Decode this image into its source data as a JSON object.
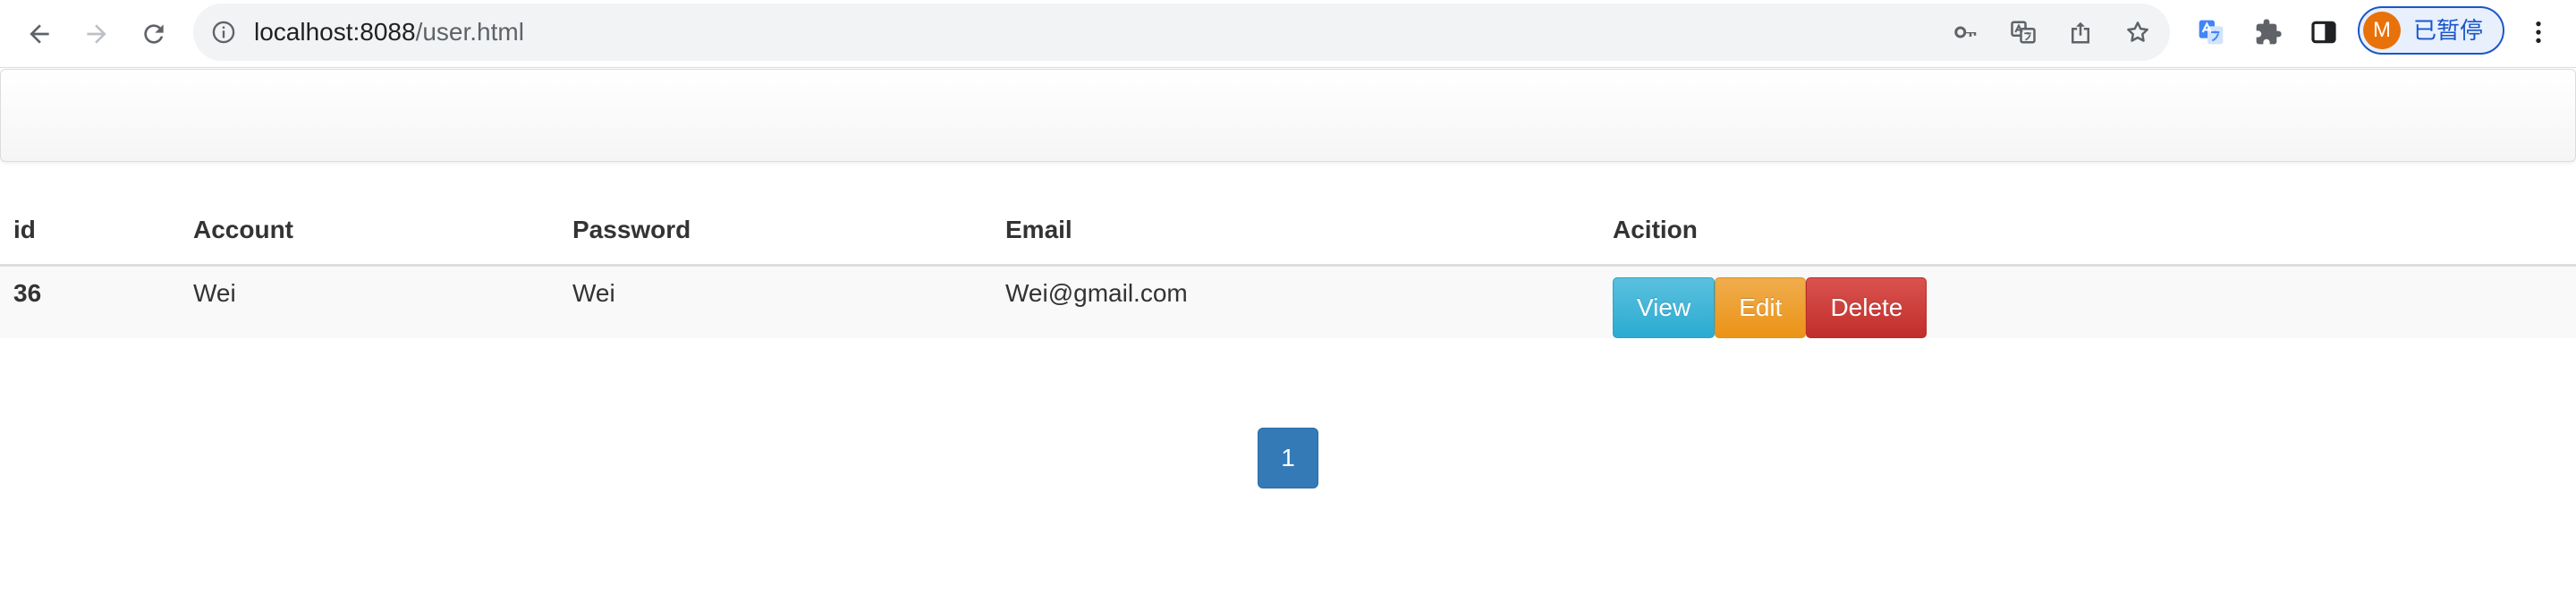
{
  "browser": {
    "url_host": "localhost:8088",
    "url_path": "/user.html",
    "profile_initial": "M",
    "profile_status": "已暂停",
    "icons": {
      "back": "back-arrow-icon",
      "forward": "forward-arrow-icon",
      "reload": "reload-icon",
      "site_info": "info-icon",
      "password": "key-icon",
      "translate": "translate-icon",
      "share": "share-icon",
      "bookmark": "star-icon",
      "translate_ext": "google-translate-icon",
      "extensions": "puzzle-icon",
      "side_panel": "side-panel-icon",
      "menu": "kebab-menu-icon"
    }
  },
  "table": {
    "headers": {
      "id": "id",
      "account": "Account",
      "password": "Password",
      "email": "Email",
      "action": "Acition"
    },
    "rows": [
      {
        "id": "36",
        "account": "Wei",
        "password": "Wei",
        "email": "Wei@gmail.com"
      }
    ],
    "actions": {
      "view": "View",
      "edit": "Edit",
      "delete": "Delete"
    }
  },
  "pagination": {
    "current_page": "1"
  },
  "colors": {
    "view": "#5bc0de",
    "edit": "#f0ad4e",
    "delete": "#d9534f",
    "page_active": "#337ab7",
    "profile_avatar": "#e8710a",
    "profile_accent": "#1a56c8"
  }
}
